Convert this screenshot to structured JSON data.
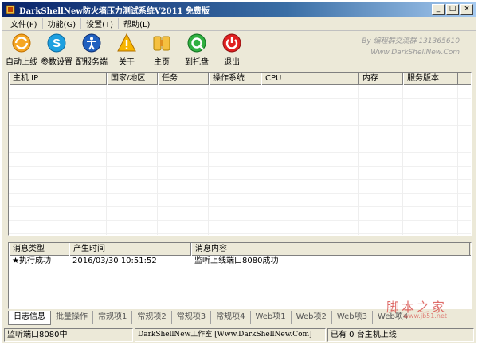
{
  "window": {
    "title": "DarkShellNew防火墙压力测试系统V2011 免费版",
    "controls": [
      "_",
      "□",
      "×"
    ]
  },
  "menu": [
    "文件(F)",
    "功能(G)",
    "设置(T)",
    "帮助(L)"
  ],
  "toolbar": {
    "buttons": [
      {
        "label": "自动上线",
        "icon": "auto-online-icon"
      },
      {
        "label": "参数设置",
        "icon": "skype-settings-icon"
      },
      {
        "label": "配服务端",
        "icon": "accessibility-config-icon"
      },
      {
        "label": "关于",
        "icon": "warning-about-icon"
      },
      {
        "label": "主页",
        "icon": "home-page-icon"
      },
      {
        "label": "到托盘",
        "icon": "tray-icon"
      },
      {
        "label": "退出",
        "icon": "power-exit-icon"
      }
    ],
    "brand_line1": "By 编程群交流群 131365610",
    "brand_line2": "Www.DarkShellNew.Com"
  },
  "host_table": {
    "columns": [
      "主机 IP",
      "国家/地区",
      "任务",
      "操作系统",
      "CPU",
      "内存",
      "服务版本"
    ],
    "rows": []
  },
  "log_table": {
    "columns": [
      "消息类型",
      "产生时间",
      "消息内容"
    ],
    "rows": [
      {
        "type": "★执行成功",
        "time": "2016/03/30 10:51:52",
        "content": "监听上线端口8080成功"
      }
    ]
  },
  "tabs": {
    "items": [
      "日志信息",
      "批量操作",
      "常规项1",
      "常规项2",
      "常规项3",
      "常规项4",
      "Web项1",
      "Web项2",
      "Web项3",
      "Web项4"
    ],
    "active": 0
  },
  "status": {
    "left": "监听端口8080中",
    "center": "DarkShellNew工作室 [Www.DarkShellNew.Com]",
    "right": "已有 0 台主机上线"
  },
  "watermark": {
    "text": "脚本之家",
    "sub": "www.jb51.net"
  },
  "colors": {
    "titlebar": "#0a246a",
    "face": "#ece9d8"
  }
}
